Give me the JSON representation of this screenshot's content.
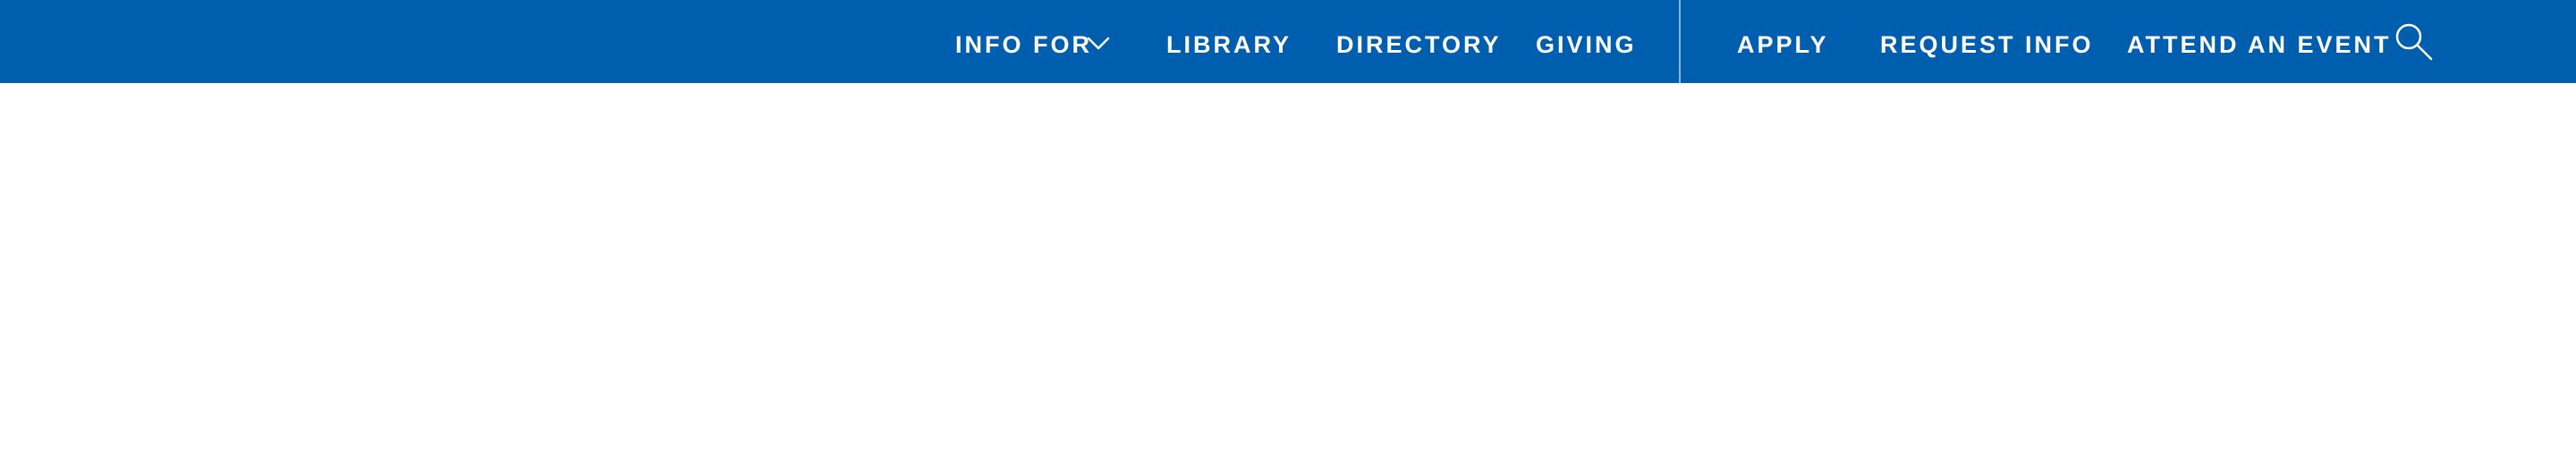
{
  "colors": {
    "nav_background": "#005eae",
    "nav_text": "#ffffff",
    "page_background": "#ffffff"
  },
  "nav": {
    "left_items": [
      {
        "label": "INFO FOR",
        "icon": "chevron-down-icon"
      },
      {
        "label": "LIBRARY"
      },
      {
        "label": "DIRECTORY"
      },
      {
        "label": "GIVING"
      }
    ],
    "right_items": [
      {
        "label": "APPLY"
      },
      {
        "label": "REQUEST INFO"
      },
      {
        "label": "ATTEND AN EVENT"
      }
    ],
    "search_icon": "search-icon"
  }
}
